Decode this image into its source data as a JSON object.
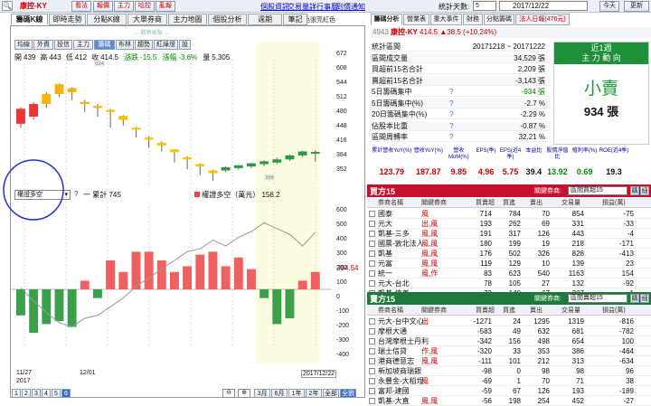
{
  "toolbar": {
    "search_icon": "search-icon",
    "stock_name": "康控-KY",
    "buttons": [
      "看法",
      "報價",
      "主力",
      "唸控",
      "亂報"
    ],
    "links": [
      "個股資訊",
      "交易量詳",
      "行事曆",
      "到價通知"
    ],
    "days_label": "統計天數:",
    "days_value": "5",
    "date_value": "2017/12/22",
    "prev": "今天",
    "refresh": "更新"
  },
  "left_tabs": [
    "籌碼K線",
    "即時走勢",
    "分點K線",
    "大單券商",
    "主力地圖",
    "個股分析",
    "週期",
    "筆記"
  ],
  "color_note": "紅紅色張亮紅色",
  "chart_buttons": [
    "均線",
    "外資",
    "投信",
    "主力",
    "籌碼",
    "布林",
    "趨勢",
    "紅綠燈",
    "設"
  ],
  "ohlc": {
    "open_l": "開",
    "open": "439",
    "high_l": "高",
    "high": "443",
    "low_l": "低",
    "low": "412",
    "close_l": "收",
    "close": "414.5",
    "chg_l": "漲跌",
    "chg": "-15.5",
    "pct_l": "漲幅",
    "pct": "-3.6%",
    "vol_l": "量",
    "vol": "5,305"
  },
  "top_marker": "← 觀察高點 →",
  "marker_high": "624",
  "marker_low": "366",
  "price_axis": [
    "672",
    "608",
    "544",
    "512",
    "480",
    "448",
    "416",
    "384",
    "352"
  ],
  "lower_select": "權證多空",
  "lower_legend": {
    "a_label": "一 累計",
    "a_value": "745",
    "b_label": "權證多空（萬元）",
    "b_value": "156.2"
  },
  "lower_axis": [
    "600",
    "500",
    "400",
    "300",
    "200",
    "100",
    "0",
    "-100",
    "-200",
    "-300",
    "-400"
  ],
  "lower_value": "394.54",
  "x_labels": {
    "a": "11/27",
    "a2": "2017",
    "b": "12/01",
    "c": "2017/12/22"
  },
  "period_buttons": [
    "1",
    "2",
    "3",
    "4",
    "5",
    "6"
  ],
  "range_buttons": [
    "3月",
    "6月",
    "1年",
    "2年",
    "全部",
    "全貌"
  ],
  "right_tabs": [
    "籌碼分析",
    "營業表",
    "重大事件",
    "財務",
    "分點籌碼",
    "法人日報(476元)"
  ],
  "stock_head": {
    "code": "4943",
    "name": "康控-KY",
    "price": "414.5",
    "chg": "▲38.5 (+10.24%)"
  },
  "stats": {
    "rows": [
      [
        "統計區間",
        "20171218 ~ 20171222"
      ],
      [
        "區間成交量",
        "34,529 張"
      ],
      [
        "買超前15名合計",
        "2,209 張"
      ],
      [
        "賣超前15名合計",
        "-3,143 張"
      ],
      [
        "5日籌碼集中",
        "-934 張"
      ],
      [
        "5日籌碼集中(%)",
        "-2.7 %"
      ],
      [
        "20日籌碼集中(%)",
        "-2.29 %"
      ],
      [
        "佔股本比重",
        "-0.87 %"
      ],
      [
        "區間周轉率",
        "32.21 %"
      ]
    ],
    "box_title": "近1週",
    "box_sub": "主 力 動 向",
    "box_main": "小賣",
    "box_val": "934 張"
  },
  "metrics": {
    "headers": [
      "累計營收YoY(%)",
      "營收YoY(%)",
      "營收MoM(%)",
      "EPS(季)",
      "EPS(近4季)",
      "本益比",
      "股價淨值比",
      "殖利率(%)",
      "ROE(近4季)"
    ],
    "values": [
      "123.79",
      "187.87",
      "9.85",
      "4.96",
      "5.75",
      "39.4",
      "13.92",
      "0.69",
      "19.3"
    ]
  },
  "buy": {
    "title": "買方15",
    "filter_l": "關鍵券商:",
    "filter": "區間買超15",
    "btn1": "購",
    "btn2": "細",
    "cols": [
      "券商名稱",
      "關鍵券商",
      "買賣超",
      "買進",
      "賣出",
      "交易量",
      "損益(萬)"
    ],
    "rows": [
      [
        "國泰",
        "風",
        714,
        784,
        70,
        854,
        -75
      ],
      [
        "元大",
        "出,風",
        193,
        262,
        69,
        331,
        -33
      ],
      [
        "凱基-三多",
        "風,風",
        191,
        317,
        126,
        443,
        -4
      ],
      [
        "國票-敦北法人",
        "風,風",
        180,
        199,
        19,
        218,
        -171
      ],
      [
        "凱基",
        "風,風",
        176,
        502,
        326,
        828,
        -413
      ],
      [
        "元富",
        "風,風",
        119,
        129,
        10,
        139,
        23
      ],
      [
        "統一",
        "風,作",
        83,
        623,
        540,
        1163,
        154
      ],
      [
        "元大-台北",
        "",
        78,
        105,
        27,
        132,
        -92
      ],
      [
        "凱基-信義",
        "",
        73,
        140,
        67,
        207,
        -1
      ]
    ]
  },
  "sell": {
    "title": "賣方15",
    "filter_l": "關鍵券商:",
    "filter": "區間賣超15",
    "btn1": "購",
    "btn2": "細",
    "cols": [
      "券商名稱",
      "關鍵券商",
      "買賣超",
      "買進",
      "賣出",
      "交易量",
      "損益(萬)"
    ],
    "rows": [
      [
        "元大-台中文心",
        "出",
        -1271,
        24,
        1295,
        1319,
        -816
      ],
      [
        "摩根大通",
        "",
        -583,
        49,
        632,
        681,
        -782
      ],
      [
        "台灣摩根士丹利",
        "",
        -342,
        156,
        498,
        654,
        100
      ],
      [
        "瑞士信貸",
        "作,風",
        -320,
        33,
        353,
        386,
        -464
      ],
      [
        "港商德意志",
        "風,風",
        -111,
        101,
        212,
        313,
        -634
      ],
      [
        "新加坡商瑞銀",
        "",
        -98,
        0,
        98,
        98,
        96
      ],
      [
        "永豐金-大稻埕",
        "風",
        -69,
        1,
        70,
        71,
        38
      ],
      [
        "富邦-建國",
        "",
        -59,
        67,
        126,
        193,
        -189
      ],
      [
        "凱基-大直",
        "風,風",
        -56,
        198,
        254,
        452,
        -27
      ]
    ]
  },
  "chart_data": {
    "type": "candlestick",
    "price_min": 352,
    "price_max": 672,
    "candles": [
      [
        510,
        548,
        500,
        552
      ],
      [
        528,
        560,
        520,
        565
      ],
      [
        560,
        585,
        550,
        590
      ],
      [
        585,
        610,
        578,
        612
      ],
      [
        590,
        600,
        570,
        602
      ],
      [
        560,
        565,
        540,
        570
      ],
      [
        550,
        555,
        528,
        560
      ],
      [
        540,
        545,
        500,
        548
      ],
      [
        520,
        530,
        505,
        532
      ],
      [
        495,
        500,
        475,
        502
      ],
      [
        470,
        475,
        450,
        478
      ],
      [
        455,
        462,
        440,
        465
      ],
      [
        438,
        445,
        412,
        446
      ],
      [
        420,
        425,
        395,
        428
      ],
      [
        402,
        408,
        380,
        410
      ],
      [
        385,
        392,
        366,
        394
      ],
      [
        392,
        400,
        388,
        402
      ],
      [
        398,
        405,
        394,
        406
      ],
      [
        402,
        410,
        398,
        412
      ],
      [
        408,
        415,
        403,
        418
      ],
      [
        412,
        420,
        408,
        424
      ],
      [
        420,
        430,
        416,
        432
      ],
      [
        430,
        440,
        426,
        442
      ],
      [
        438,
        439,
        414.5,
        443
      ]
    ],
    "warrant": [
      -180,
      -300,
      -240,
      -220,
      -260,
      60,
      -60,
      200,
      120,
      260,
      260,
      200,
      120,
      160,
      240,
      260,
      160,
      220,
      140,
      -60,
      -240,
      -200,
      60,
      120
    ],
    "cumulative": [
      10,
      -80,
      -160,
      -230,
      -260,
      -200,
      -180,
      -120,
      -60,
      20,
      80,
      140,
      200,
      260,
      280,
      340,
      300,
      360,
      400,
      460,
      420,
      380,
      300,
      394
    ],
    "lower_min": -400,
    "lower_max": 600
  }
}
